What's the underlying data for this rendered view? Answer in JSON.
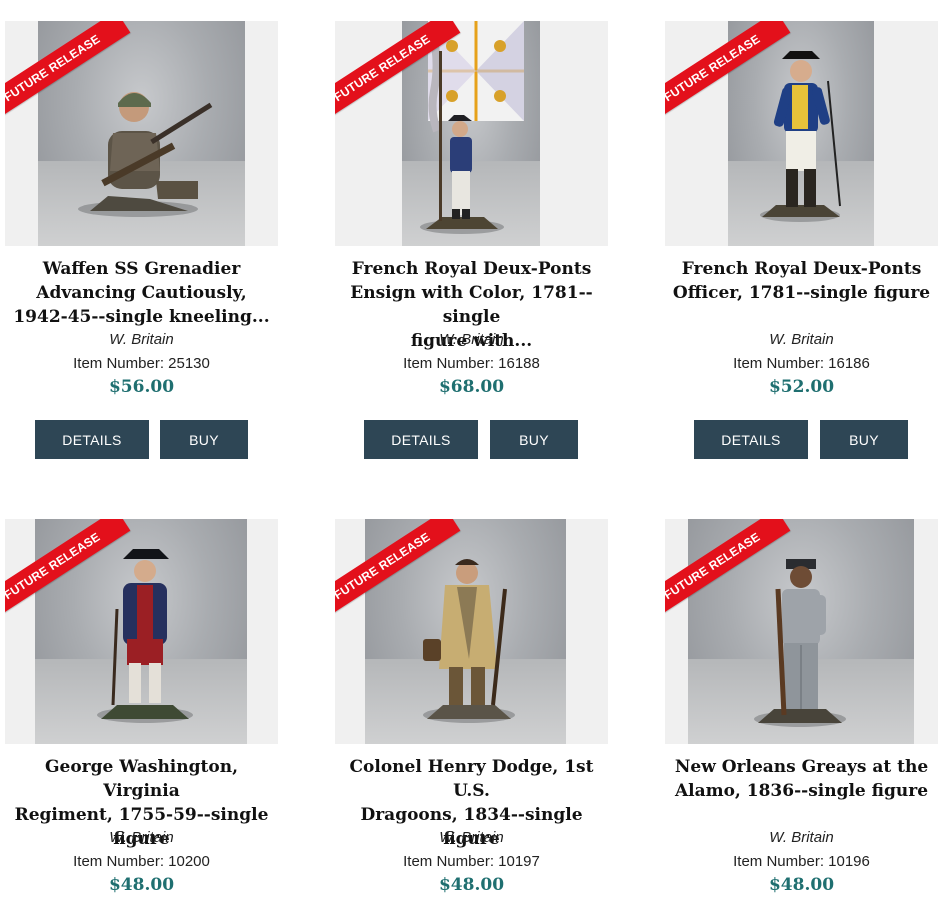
{
  "ribbon_label": "FUTURE RELEASE",
  "buttons": {
    "details": "DETAILS",
    "buy": "BUY"
  },
  "colors": {
    "ribbon": "#e3101b",
    "button": "#2e4655",
    "price": "#1f6f70"
  },
  "products": [
    {
      "title_lines": [
        "Waffen SS Grenadier",
        "Advancing Cautiously,",
        "1942-45--single kneeling..."
      ],
      "brand": "W. Britain",
      "item_number": "Item Number: 25130",
      "price": "$56.00"
    },
    {
      "title_lines": [
        "French Royal Deux-Ponts",
        "Ensign with Color, 1781--single",
        "figure with..."
      ],
      "brand": "W. Britain",
      "item_number": "Item Number: 16188",
      "price": "$68.00"
    },
    {
      "title_lines": [
        "French Royal Deux-Ponts",
        "Officer, 1781--single figure"
      ],
      "brand": "W. Britain",
      "item_number": "Item Number: 16186",
      "price": "$52.00"
    },
    {
      "title_lines": [
        "George Washington, Virginia",
        "Regiment, 1755-59--single",
        "figure"
      ],
      "brand": "W. Britain",
      "item_number": "Item Number: 10200",
      "price": "$48.00"
    },
    {
      "title_lines": [
        "Colonel Henry Dodge, 1st U.S.",
        "Dragoons, 1834--single figure"
      ],
      "brand": "W. Britain",
      "item_number": "Item Number: 10197",
      "price": "$48.00"
    },
    {
      "title_lines": [
        "New Orleans Greays at the",
        "Alamo, 1836--single figure"
      ],
      "brand": "W. Britain",
      "item_number": "Item Number: 10196",
      "price": "$48.00"
    }
  ]
}
